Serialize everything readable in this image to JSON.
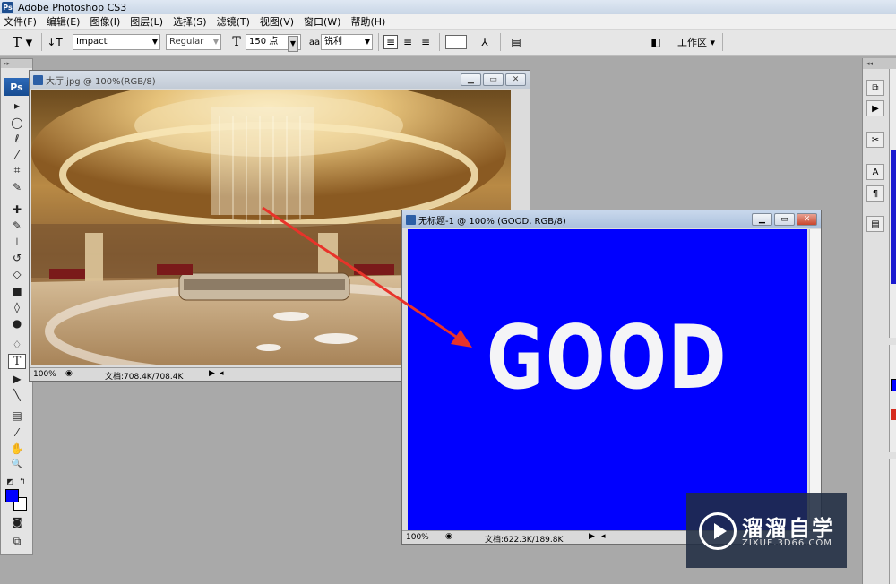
{
  "app": {
    "title": "Adobe Photoshop CS3",
    "logo": "Ps"
  },
  "menu": [
    "文件(F)",
    "编辑(E)",
    "图像(I)",
    "图层(L)",
    "选择(S)",
    "滤镜(T)",
    "视图(V)",
    "窗口(W)",
    "帮助(H)"
  ],
  "options": {
    "font_family": "Impact",
    "font_style": "Regular",
    "font_size": "150 点",
    "aa_label": "aa",
    "antialias": "锐利",
    "workspace": "工作区 ▾"
  },
  "tools": [
    {
      "name": "move-tool-icon",
      "glyph": "▸"
    },
    {
      "name": "marquee-tool-icon",
      "glyph": "◯"
    },
    {
      "name": "lasso-tool-icon",
      "glyph": "ℓ"
    },
    {
      "name": "magic-wand-tool-icon",
      "glyph": "⁄"
    },
    {
      "name": "crop-tool-icon",
      "glyph": "⌗"
    },
    {
      "name": "slice-tool-icon",
      "glyph": "✎"
    },
    {
      "name": "healing-tool-icon",
      "glyph": "✚"
    },
    {
      "name": "brush-tool-icon",
      "glyph": "✎"
    },
    {
      "name": "stamp-tool-icon",
      "glyph": "⊥"
    },
    {
      "name": "history-brush-tool-icon",
      "glyph": "↺"
    },
    {
      "name": "eraser-tool-icon",
      "glyph": "◇"
    },
    {
      "name": "gradient-tool-icon",
      "glyph": "■"
    },
    {
      "name": "blur-tool-icon",
      "glyph": "◊"
    },
    {
      "name": "dodge-tool-icon",
      "glyph": "●"
    },
    {
      "name": "pen-tool-icon",
      "glyph": "♢"
    },
    {
      "name": "type-tool-icon",
      "glyph": "T"
    },
    {
      "name": "path-select-tool-icon",
      "glyph": "▶"
    },
    {
      "name": "line-tool-icon",
      "glyph": "╲"
    },
    {
      "name": "notes-tool-icon",
      "glyph": "▤"
    },
    {
      "name": "eyedropper-tool-icon",
      "glyph": "⁄"
    },
    {
      "name": "hand-tool-icon",
      "glyph": "✋"
    },
    {
      "name": "zoom-tool-icon",
      "glyph": "🔍"
    }
  ],
  "colors": {
    "foreground": "#0000ff",
    "background": "#ffffff",
    "canvas_blue": "#0000ff"
  },
  "doc1": {
    "title": "大厅.jpg @ 100%(RGB/8)",
    "zoom": "100%",
    "docsize": "文档:708.4K/708.4K"
  },
  "doc2": {
    "title": "无标题-1 @ 100% (GOOD, RGB/8)",
    "zoom": "100%",
    "docsize": "文档:622.3K/189.8K",
    "canvas_text": "GOOD"
  },
  "watermark": {
    "title": "溜溜自学",
    "subtitle": "ZIXUE.3D66.COM"
  }
}
